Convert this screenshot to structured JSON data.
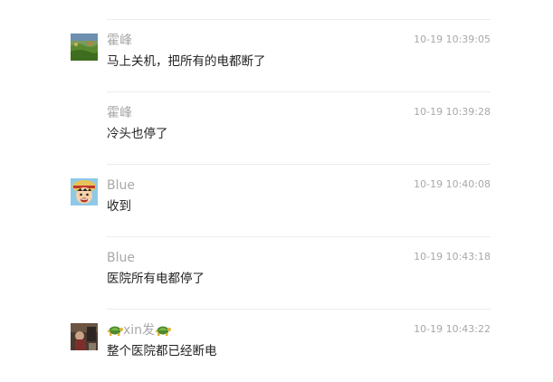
{
  "messages": [
    {
      "name": "霍峰",
      "time": "10-19 10:39:05",
      "text": "马上关机，把所有的电都断了",
      "avatar": "landscape-avatar",
      "show_avatar": true
    },
    {
      "name": "霍峰",
      "time": "10-19 10:39:28",
      "text": "冷头也停了",
      "avatar": "",
      "show_avatar": false
    },
    {
      "name": "Blue",
      "time": "10-19 10:40:08",
      "text": "收到",
      "avatar": "cartoon-boy-avatar",
      "show_avatar": true
    },
    {
      "name": "Blue",
      "time": "10-19 10:43:18",
      "text": "医院所有电都停了",
      "avatar": "",
      "show_avatar": false
    },
    {
      "name": "xin发",
      "time": "10-19 10:43:22",
      "text": "整个医院都已经断电",
      "avatar": "photo-avatar",
      "show_avatar": true,
      "name_icons": [
        "turtle-icon",
        "turtle-icon"
      ]
    }
  ]
}
